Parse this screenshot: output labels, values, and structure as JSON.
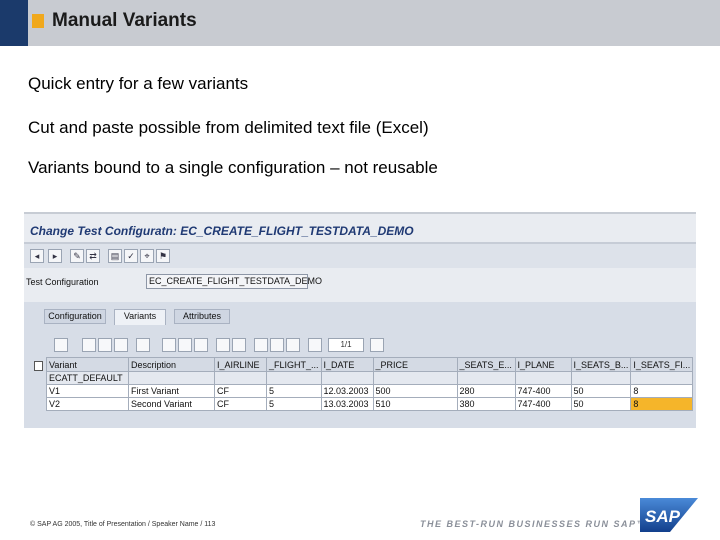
{
  "slide": {
    "title": "Manual Variants",
    "bullets": [
      "Quick entry for a few variants",
      "Cut and paste possible from delimited text file (Excel)",
      "Variants bound to a single configuration – not reusable"
    ],
    "footer": "© SAP AG 2005, Title of Presentation / Speaker Name / 113",
    "tagline": "THE BEST-RUN BUSINESSES RUN SAP™",
    "logo_text": "SAP"
  },
  "gui": {
    "title": "Change Test Configuratn: EC_CREATE_FLIGHT_TESTDATA_DEMO",
    "test_config_label": "Test Configuration",
    "test_config_value": "EC_CREATE_FLIGHT_TESTDATA_DEMO",
    "tabs": [
      "Configuration",
      "Variants",
      "Attributes"
    ],
    "active_tab": "Variants",
    "pager": "1/1",
    "columns": [
      "Variant",
      "Description",
      "I_AIRLINE",
      "_FLIGHT_...",
      "I_DATE",
      "_PRICE",
      "_SEATS_E...",
      "I_PLANE",
      "I_SEATS_B...",
      "I_SEATS_FI..."
    ],
    "default_label": "ECATT_DEFAULT",
    "rows": [
      [
        "V1",
        "First Variant",
        "CF",
        "5",
        "12.03.2003",
        "500",
        "280",
        "747-400",
        "50",
        "8"
      ],
      [
        "V2",
        "Second Variant",
        "CF",
        "5",
        "13.03.2003",
        "510",
        "380",
        "747-400",
        "50",
        "8"
      ]
    ],
    "highlight_color": "#f5b52a"
  }
}
